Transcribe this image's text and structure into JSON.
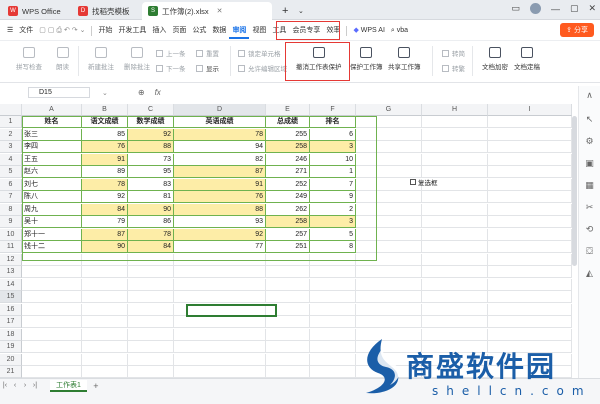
{
  "window": {
    "tabs": [
      {
        "label": "WPS Office",
        "color": "#e53935"
      },
      {
        "label": "找稻壳模板",
        "color": "#e53935"
      },
      {
        "label": "工作簿(2).xlsx",
        "color": "#2e7d32"
      }
    ],
    "right_icons": [
      "layout-icon",
      "avatar",
      "minimize-icon",
      "maximize-icon",
      "close-icon"
    ]
  },
  "menubar": {
    "file": "文件",
    "items": [
      "开始",
      "开发工具",
      "插入",
      "页面",
      "公式",
      "数据",
      "审阅",
      "视图",
      "工具",
      "会员专享",
      "效率"
    ],
    "selected": "审阅",
    "wps_ai": "WPS AI",
    "search": "vba",
    "share": "分享"
  },
  "ribbon": {
    "spell_check": "拼写检查",
    "read": "朗读",
    "new_comment": "新建批注",
    "delete_comment": "删除批注",
    "prev": "上一条",
    "next": "下一条",
    "reset": "重置",
    "show": "显示",
    "lock_cell": "锁定单元格",
    "allow_edit": "允许编辑区域",
    "unprotect_sheet": "撤消工作表保护",
    "protect_workbook": "保护工作簿",
    "share_workbook": "共享工作簿",
    "trad_simp": "转简",
    "simp_trad": "转繁",
    "doc_encrypt": "文档加密",
    "doc_finalize": "文档定稿"
  },
  "formula_bar": {
    "cell_ref": "D15",
    "fx": "fx"
  },
  "sheet": {
    "columns": [
      "A",
      "B",
      "C",
      "D",
      "E",
      "F",
      "G",
      "H",
      "I"
    ],
    "selected_column": "D",
    "rows": [
      "1",
      "2",
      "3",
      "4",
      "5",
      "6",
      "7",
      "8",
      "9",
      "10",
      "11",
      "12",
      "13",
      "14",
      "15",
      "16",
      "17",
      "18",
      "19",
      "20",
      "21",
      "22"
    ],
    "selected_row": "15",
    "headers": [
      "姓名",
      "语文成绩",
      "数学成绩",
      "英语成绩",
      "总成绩",
      "排名"
    ],
    "data": [
      [
        "张三",
        "85",
        "92",
        "78",
        "255",
        "6"
      ],
      [
        "李四",
        "76",
        "88",
        "94",
        "258",
        "3"
      ],
      [
        "王五",
        "91",
        "73",
        "82",
        "246",
        "10"
      ],
      [
        "赵六",
        "89",
        "95",
        "87",
        "271",
        "1"
      ],
      [
        "刘七",
        "78",
        "83",
        "91",
        "252",
        "7"
      ],
      [
        "陈八",
        "92",
        "81",
        "76",
        "249",
        "9"
      ],
      [
        "周九",
        "84",
        "90",
        "88",
        "262",
        "2"
      ],
      [
        "吴十",
        "79",
        "86",
        "93",
        "258",
        "3"
      ],
      [
        "郑十一",
        "87",
        "78",
        "92",
        "257",
        "5"
      ],
      [
        "钱十二",
        "90",
        "84",
        "77",
        "251",
        "8"
      ]
    ],
    "highlight": [
      [
        false,
        false,
        true,
        true,
        false,
        false
      ],
      [
        false,
        true,
        true,
        false,
        true,
        true
      ],
      [
        false,
        true,
        false,
        false,
        false,
        false
      ],
      [
        false,
        false,
        false,
        true,
        false,
        false
      ],
      [
        false,
        true,
        false,
        true,
        false,
        false
      ],
      [
        false,
        false,
        false,
        true,
        false,
        false
      ],
      [
        false,
        true,
        true,
        true,
        false,
        false
      ],
      [
        false,
        false,
        false,
        false,
        true,
        true
      ],
      [
        false,
        true,
        true,
        true,
        false,
        false
      ],
      [
        false,
        true,
        true,
        false,
        false,
        false
      ]
    ],
    "checkbox_label": "复选框",
    "highlight_color": "#fdeda7",
    "border_color": "#6fb24f"
  },
  "sheet_tabs": {
    "active": "工作表1",
    "add": "+"
  },
  "watermark": {
    "title": "商盛软件园",
    "url": "shellcn.com"
  }
}
